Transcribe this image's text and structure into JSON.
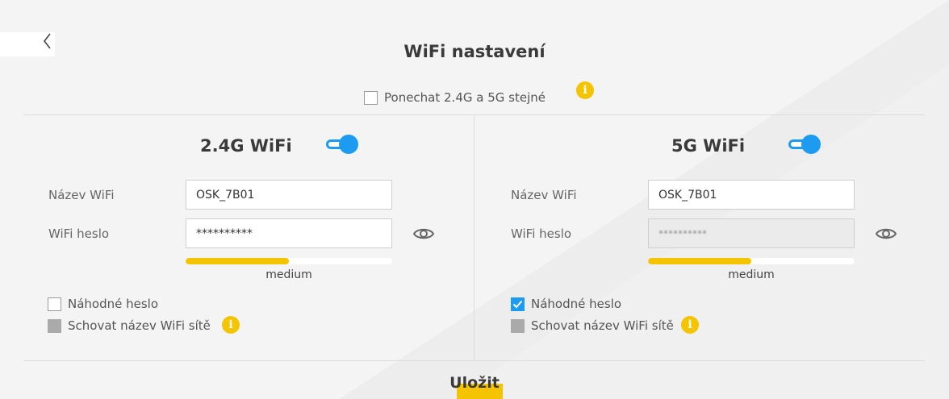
{
  "page": {
    "title": "WiFi nastavení",
    "keep_same_label": "Ponechat 2.4G a 5G stejné",
    "keep_same_checked": false
  },
  "colors": {
    "accent": "#1d9bf0",
    "warning": "#f5c400"
  },
  "wifi24": {
    "title": "2.4G WiFi",
    "enabled": true,
    "name_label": "Název WiFi",
    "name_value": "OSK_7B01",
    "password_label": "WiFi heslo",
    "password_value": "**********",
    "strength_label": "medium",
    "strength_fraction": 0.5,
    "random_password_label": "Náhodné heslo",
    "random_password_checked": false,
    "hide_ssid_label": "Schovat název WiFi sítě",
    "hide_ssid_disabled": true
  },
  "wifi5": {
    "title": "5G WiFi",
    "enabled": true,
    "name_label": "Název WiFi",
    "name_value": "OSK_7B01",
    "password_label": "WiFi heslo",
    "password_value": "**********",
    "strength_label": "medium",
    "strength_fraction": 0.5,
    "random_password_label": "Náhodné heslo",
    "random_password_checked": true,
    "hide_ssid_label": "Schovat název WiFi sítě",
    "hide_ssid_disabled": true
  },
  "icons": {
    "back": "chevron-left-icon",
    "info": "info-icon",
    "show_password": "eye-icon"
  },
  "actions": {
    "save_label": "Uložit"
  }
}
